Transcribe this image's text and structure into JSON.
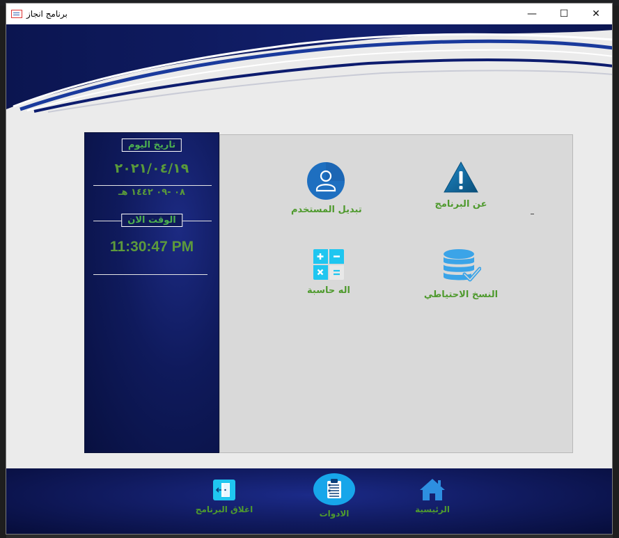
{
  "window": {
    "title": "برنامج انجاز",
    "minimize": "—",
    "maximize": "☐",
    "close": "✕"
  },
  "date_panel": {
    "today_label": "تاريخ اليوم",
    "gregorian_date": "٢٠٢١/٠٤/١٩",
    "hijri_date": "٠٨ -٠٩ ١٤٤٢ هـ",
    "time_label": "الوقت الان",
    "clock": "11:30:47 PM"
  },
  "tools": [
    {
      "id": "about",
      "label": "عن البرنامج",
      "icon": "warning-icon"
    },
    {
      "id": "switch_user",
      "label": "تبديل المستخدم",
      "icon": "user-icon"
    },
    {
      "id": "backup",
      "label": "النسخ الاحتياطي",
      "icon": "database-check-icon"
    },
    {
      "id": "calculator",
      "label": "اله حاسبة",
      "icon": "calculator-icon"
    }
  ],
  "bottom_nav": [
    {
      "id": "home",
      "label": "الرئيسية",
      "icon": "home-icon"
    },
    {
      "id": "tools",
      "label": "الادوات",
      "icon": "clipboard-icon",
      "active": true
    },
    {
      "id": "exit",
      "label": "اغلاق البرنامج",
      "icon": "exit-door-icon"
    }
  ],
  "colors": {
    "navy": "#0f1a5c",
    "green_text": "#4f9a2e",
    "tools_bg": "#d9d9d9",
    "window_bg": "#ebebeb",
    "accent_blue": "#1e88e5"
  }
}
